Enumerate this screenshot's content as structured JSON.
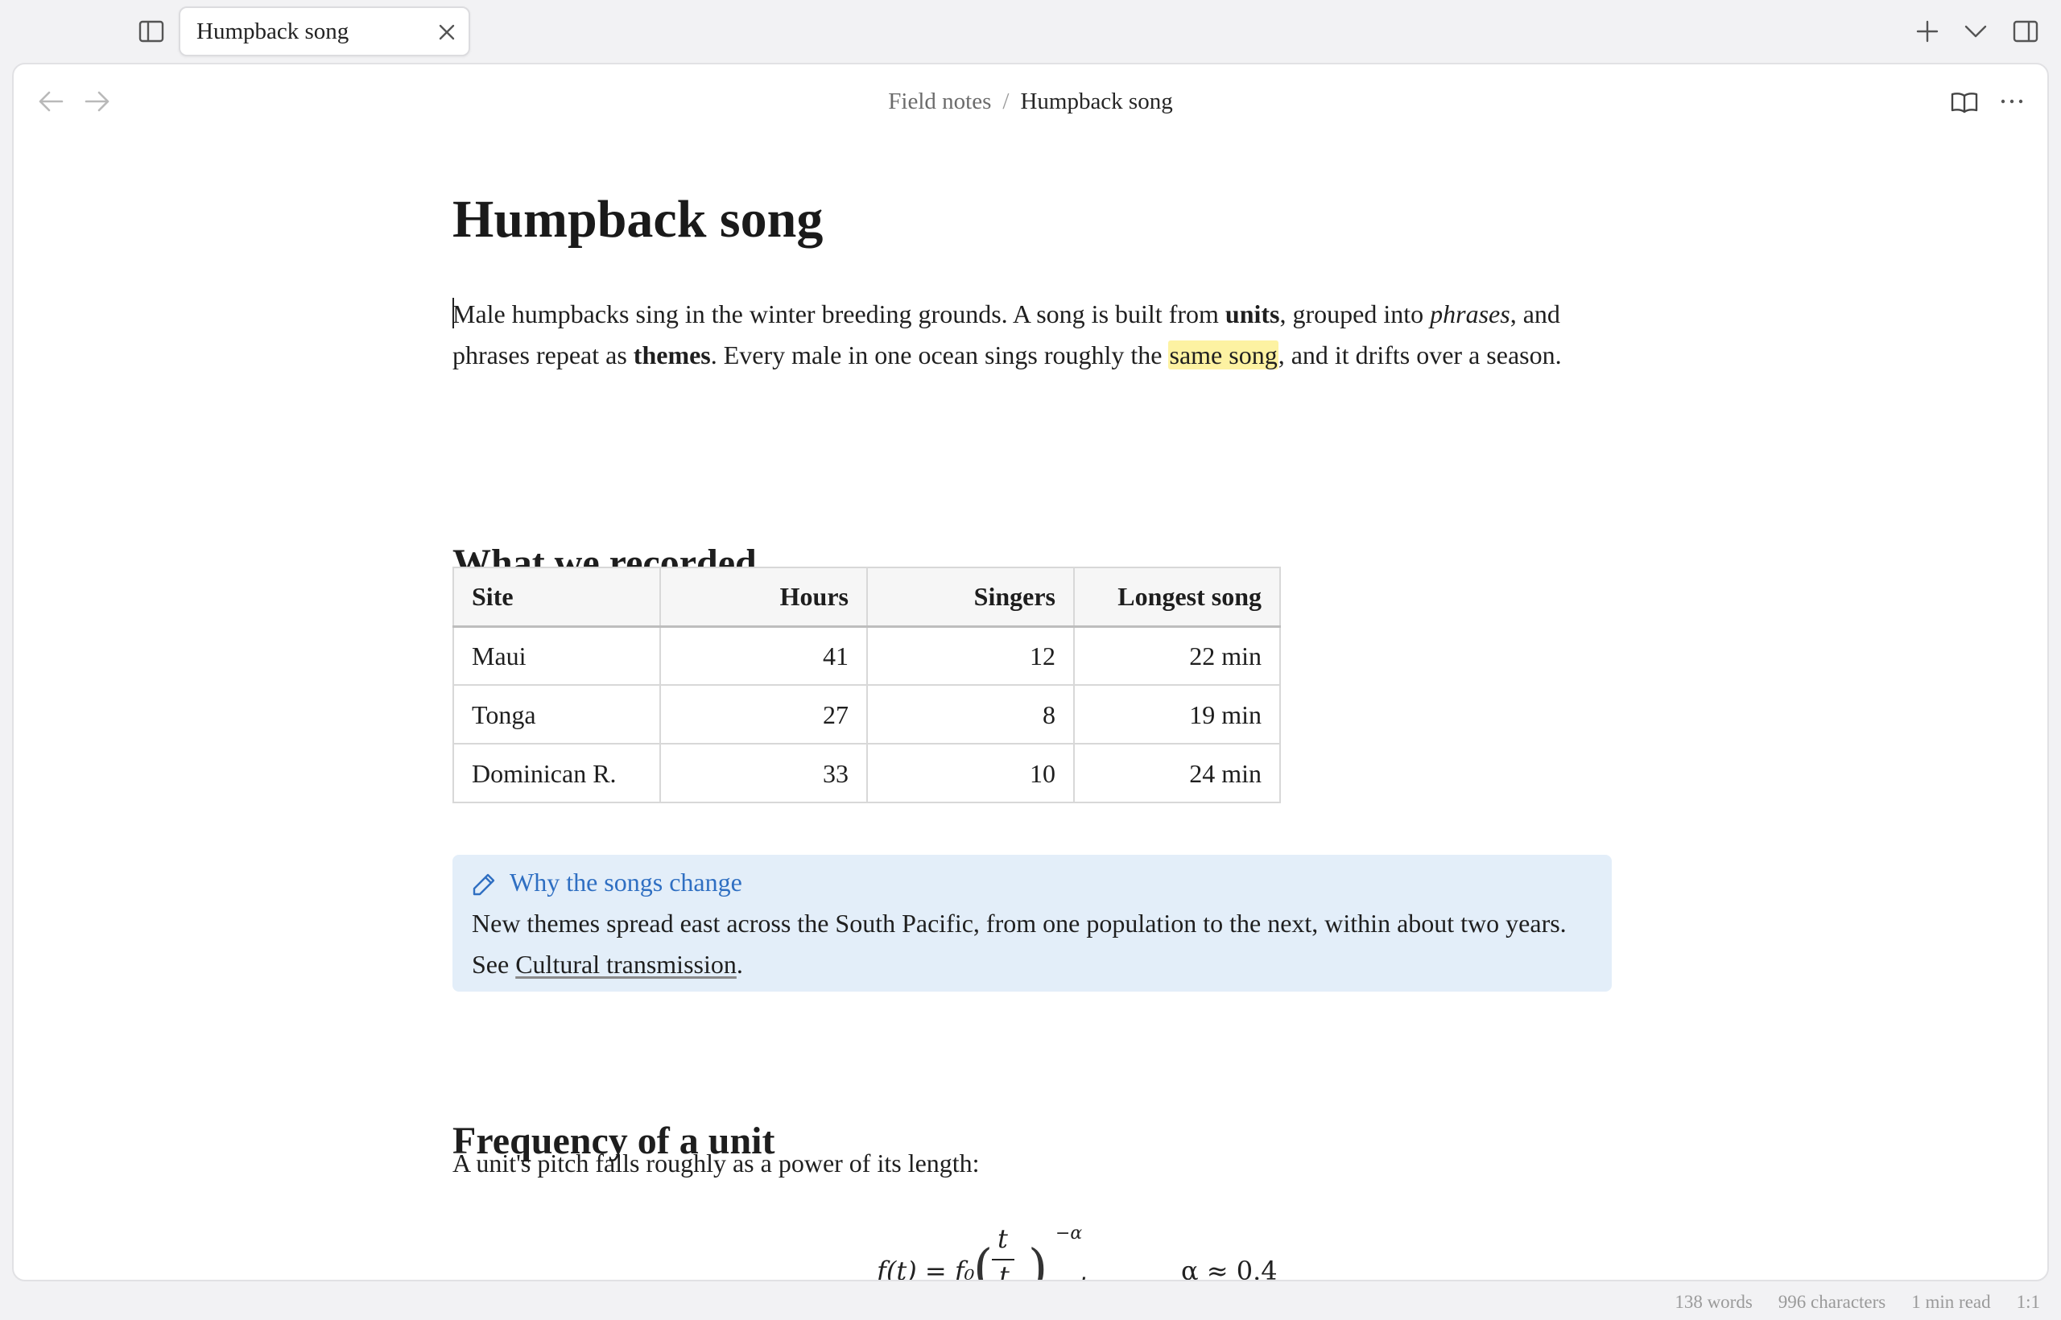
{
  "tab": {
    "title": "Humpback song"
  },
  "breadcrumb": {
    "parent": "Field notes",
    "separator": "/",
    "current": "Humpback song"
  },
  "doc": {
    "title": "Humpback song",
    "intro": {
      "t1": "Male humpbacks sing in the winter breeding grounds. A song is built from ",
      "b1": "units",
      "t2": ", grouped into ",
      "i1": "phrases",
      "t3": ", and phrases repeat as ",
      "b2": "themes",
      "t4": ". Every male in one ocean sings roughly the ",
      "highlight": "same song",
      "t5": ", and it drifts over a season."
    },
    "section_recorded": "What we recorded",
    "table": {
      "headers": [
        "Site",
        "Hours",
        "Singers",
        "Longest song"
      ],
      "rows": [
        [
          "Maui",
          "41",
          "12",
          "22 min"
        ],
        [
          "Tonga",
          "27",
          "8",
          "19 min"
        ],
        [
          "Dominican R.",
          "33",
          "10",
          "24 min"
        ]
      ]
    },
    "callout": {
      "title": "Why the songs change",
      "body": "New themes spread east across the South Pacific, from one population to the next, within about two years. See ",
      "link": "Cultural transmission",
      "end": "."
    },
    "section_frequency": "Frequency of a unit",
    "frequency_text": "A unit's pitch falls roughly as a power of its length:",
    "formula": {
      "lhs": "f(t) = f₀",
      "num": "t",
      "den": "t",
      "exp": "−α",
      "comma": ",",
      "alpha": "α ≈ 0.4"
    }
  },
  "status": {
    "words": "138 words",
    "chars": "996 characters",
    "read": "1 min read",
    "pos": "1:1"
  },
  "icons": {
    "sidebar": "sidebar-toggle-icon",
    "close": "close-icon",
    "new_tab": "plus-icon",
    "tab_list": "chevron-down-icon",
    "right_sidebar": "right-sidebar-icon",
    "back": "arrow-left-icon",
    "forward": "arrow-right-icon",
    "reading": "book-open-icon",
    "more": "more-options-icon",
    "callout": "pencil-icon"
  },
  "colors": {
    "highlight": "#fdf2a2",
    "callout_bg": "#e3eef9",
    "callout_title": "#2f6fc2"
  }
}
